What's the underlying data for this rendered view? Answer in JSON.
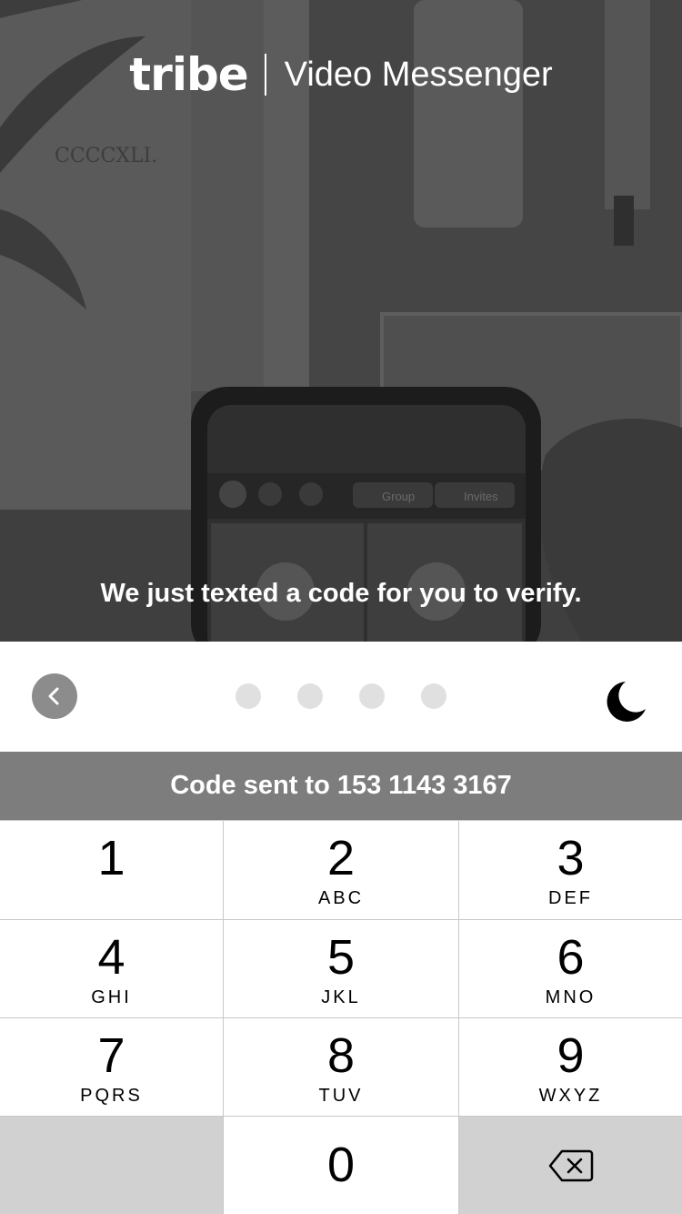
{
  "header": {
    "logo": "tribe",
    "tagline": "Video Messenger"
  },
  "hero": {
    "message": "We just texted a code for you to verify.",
    "bg_text": {
      "roman": "CCCCXLI.",
      "chip_group": "Group",
      "chip_invites": "Invites"
    }
  },
  "progress": {
    "dots_total": 4,
    "dots_filled": 0
  },
  "banner": {
    "text": "Code sent to 153 1143 3167"
  },
  "keypad": {
    "keys": [
      {
        "digit": "1",
        "letters": ""
      },
      {
        "digit": "2",
        "letters": "ABC"
      },
      {
        "digit": "3",
        "letters": "DEF"
      },
      {
        "digit": "4",
        "letters": "GHI"
      },
      {
        "digit": "5",
        "letters": "JKL"
      },
      {
        "digit": "6",
        "letters": "MNO"
      },
      {
        "digit": "7",
        "letters": "PQRS"
      },
      {
        "digit": "8",
        "letters": "TUV"
      },
      {
        "digit": "9",
        "letters": "WXYZ"
      },
      {
        "digit": "0",
        "letters": ""
      }
    ]
  },
  "icons": {
    "back": "chevron-left-icon",
    "theme": "moon-icon",
    "delete": "backspace-icon"
  },
  "colors": {
    "banner_bg": "#7d7d7d",
    "back_btn_bg": "#8c8c8c",
    "dot_empty": "#e0e0e0",
    "key_gray": "#d1d1d1"
  }
}
